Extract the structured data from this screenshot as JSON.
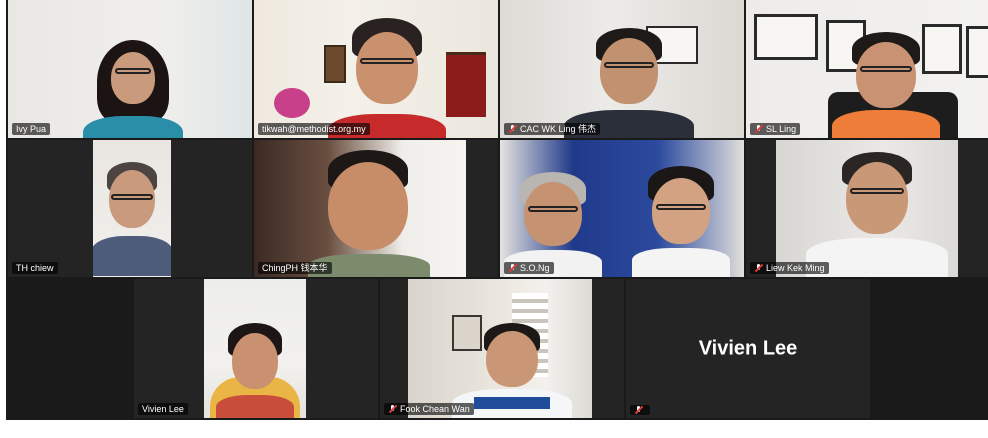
{
  "app": {
    "view": "Gallery View"
  },
  "participants": [
    {
      "name": "Ivy Pua",
      "muted": false,
      "active": true
    },
    {
      "name": "tikwah@methodist.org.my",
      "muted": false,
      "active": false
    },
    {
      "name": "CAC WK Ling 伟杰",
      "muted": true,
      "active": false
    },
    {
      "name": "SL Ling",
      "muted": true,
      "active": false
    },
    {
      "name": "TH chiew",
      "muted": false,
      "active": false
    },
    {
      "name": "ChingPH 钱本华",
      "muted": false,
      "active": false
    },
    {
      "name": "S.O.Ng",
      "muted": true,
      "active": false
    },
    {
      "name": "Liew Kek Ming",
      "muted": true,
      "active": false
    },
    {
      "name": "Vivien Lee",
      "muted": false,
      "active": false
    },
    {
      "name": "Fook Chean Wan",
      "muted": true,
      "active": false
    },
    {
      "name": "",
      "display_name": "Vivien Lee",
      "muted": true,
      "active": false,
      "video_off": true
    }
  ],
  "colors": {
    "active_speaker": "#c8e650",
    "tile_bg": "#242424",
    "muted_icon": "#e0393b"
  }
}
